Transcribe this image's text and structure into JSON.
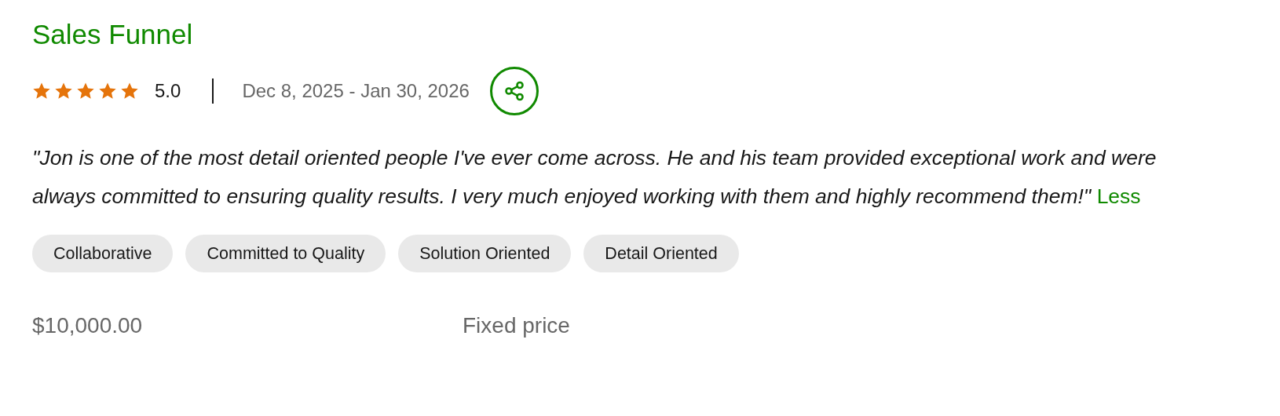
{
  "title": "Sales Funnel",
  "rating": {
    "stars": 5,
    "score": "5.0"
  },
  "date_range": "Dec 8, 2025 - Jan 30, 2026",
  "review": {
    "text": "\"Jon is one of the most detail oriented people I've ever come across. He and his team provided exceptional work and were always committed to ensuring quality results. I very much enjoyed working with them and highly recommend them!\"",
    "toggle_link": "Less"
  },
  "tags": [
    "Collaborative",
    "Committed to Quality",
    "Solution Oriented",
    "Detail Oriented"
  ],
  "price": "$10,000.00",
  "price_type": "Fixed price"
}
